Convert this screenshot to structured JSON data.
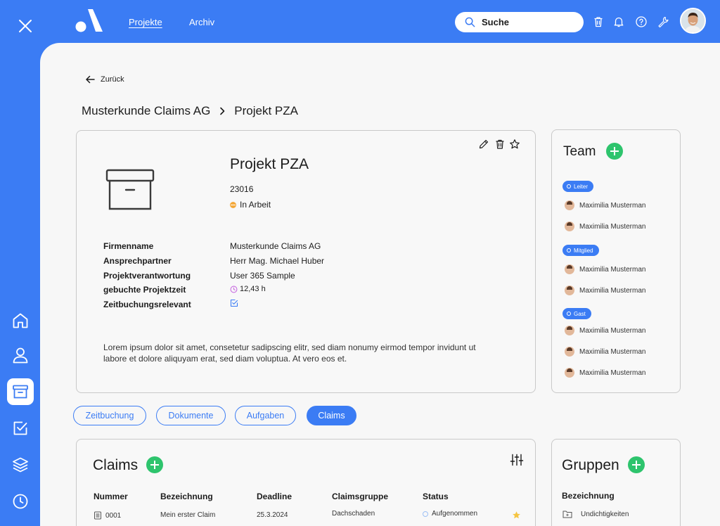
{
  "header": {
    "nav": [
      {
        "label": "Projekte",
        "active": true
      },
      {
        "label": "Archiv",
        "active": false
      }
    ],
    "search_placeholder": "Suche",
    "icons": [
      "trash-icon",
      "bell-icon",
      "help-icon",
      "wrench-icon"
    ]
  },
  "sidebar": {
    "items": [
      "home-icon",
      "user-icon",
      "archive-icon",
      "checkbox-icon",
      "layers-icon",
      "clock-icon"
    ],
    "active": "archive-icon"
  },
  "page": {
    "back_label": "Zurück",
    "breadcrumb": [
      "Musterkunde Claims AG",
      "Projekt PZA"
    ]
  },
  "project": {
    "title": "Projekt PZA",
    "number": "23016",
    "status": "In Arbeit",
    "status_color": "#f4a93b",
    "fields": [
      {
        "label": "Firmenname",
        "value": "Musterkunde Claims AG"
      },
      {
        "label": "Ansprechpartner",
        "value": "Herr Mag. Michael Huber"
      },
      {
        "label": "Projektverantwortung",
        "value": "User 365 Sample"
      },
      {
        "label": "gebuchte Projektzeit",
        "value": "12,43 h"
      },
      {
        "label": "Zeitbuchungsrelevant",
        "value": ""
      }
    ],
    "description": "Lorem ipsum dolor sit amet, consetetur sadipscing elitr, sed diam nonumy eirmod tempor invidunt ut labore et dolore  aliquyam erat, sed diam voluptua. At vero eos et."
  },
  "team": {
    "title": "Team",
    "groups": [
      {
        "role": "Leiter",
        "members": [
          "Maximilia Musterman",
          "Maximilia Musterman"
        ]
      },
      {
        "role": "Mitglied",
        "members": [
          "Maximilia Musterman",
          "Maximilia Musterman"
        ]
      },
      {
        "role": "Gast",
        "members": [
          "Maximilia Musterman",
          "Maximilia Musterman",
          "Maximilia Musterman"
        ]
      }
    ]
  },
  "tabs": [
    {
      "label": "Zeitbuchung",
      "active": false
    },
    {
      "label": "Dokumente",
      "active": false
    },
    {
      "label": "Aufgaben",
      "active": false
    },
    {
      "label": "Claims",
      "active": true
    }
  ],
  "claims": {
    "title": "Claims",
    "columns": [
      "Nummer",
      "Bezeichnung",
      "Deadline",
      "Claimsgruppe",
      "Status"
    ],
    "rows": [
      {
        "nummer": "0001",
        "bezeichnung": "Mein erster Claim",
        "deadline": "25.3.2024",
        "gruppe": "Dachschaden",
        "status": "Aufgenommen",
        "starred": true
      }
    ]
  },
  "gruppen": {
    "title": "Gruppen",
    "column": "Bezeichnung",
    "rows": [
      "Undichtigkeiten"
    ]
  },
  "colors": {
    "accent": "#3b7cf4",
    "add_green": "#2ec46d",
    "star": "#f5c542",
    "time_icon": "#c86be0"
  }
}
